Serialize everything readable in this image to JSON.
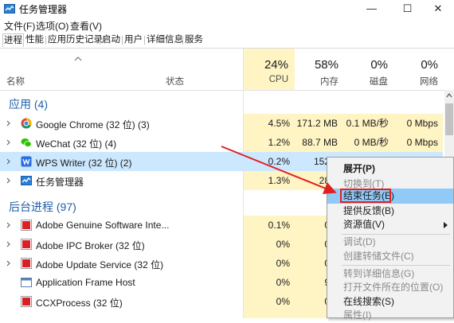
{
  "window": {
    "title": "任务管理器",
    "minimize": "—",
    "maximize": "☐",
    "close": "✕"
  },
  "menu": [
    "文件(F)",
    "选项(O)",
    "查看(V)"
  ],
  "tabs": [
    "进程",
    "性能",
    "应用历史记录",
    "启动",
    "用户",
    "详细信息",
    "服务"
  ],
  "columns": {
    "name": "名称",
    "status": "状态",
    "cpu": {
      "pct": "24%",
      "label": "CPU"
    },
    "mem": {
      "pct": "58%",
      "label": "内存"
    },
    "disk": {
      "pct": "0%",
      "label": "磁盘"
    },
    "net": {
      "pct": "0%",
      "label": "网络"
    }
  },
  "groups": {
    "apps": "应用 (4)",
    "background": "后台进程 (97)"
  },
  "apps": [
    {
      "name": "Google Chrome (32 位) (3)",
      "icon": "chrome-icon",
      "cpu": "4.5%",
      "mem": "171.2 MB",
      "disk": "0.1 MB/秒",
      "net": "0 Mbps"
    },
    {
      "name": "WeChat (32 位) (4)",
      "icon": "wechat-icon",
      "cpu": "1.2%",
      "mem": "88.7 MB",
      "disk": "0 MB/秒",
      "net": "0 Mbps"
    },
    {
      "name": "WPS Writer (32 位) (2)",
      "icon": "wps-writer-icon",
      "cpu": "0.2%",
      "mem": "152.6",
      "disk": "",
      "net": ""
    },
    {
      "name": "任务管理器",
      "icon": "task-manager-icon",
      "cpu": "1.3%",
      "mem": "28.0",
      "disk": "",
      "net": ""
    }
  ],
  "background": [
    {
      "name": "Adobe Genuine Software Inte...",
      "icon": "adobe-icon",
      "cpu": "0.1%",
      "mem": "0.2"
    },
    {
      "name": "Adobe IPC Broker (32 位)",
      "icon": "adobe-icon",
      "cpu": "0%",
      "mem": "0.3"
    },
    {
      "name": "Adobe Update Service (32 位)",
      "icon": "adobe-icon",
      "cpu": "0%",
      "mem": "0.3"
    },
    {
      "name": "Application Frame Host",
      "icon": "app-frame-icon",
      "cpu": "0%",
      "mem": "9.7"
    },
    {
      "name": "CCXProcess (32 位)",
      "icon": "adobe-icon",
      "cpu": "0%",
      "mem": "0.3"
    }
  ],
  "context_menu": [
    {
      "label": "展开(P)",
      "style": "bold"
    },
    {
      "label": "切换到(T)",
      "style": "disabled"
    },
    {
      "label": "结束任务(E)",
      "style": "hl"
    },
    {
      "label": "提供反馈(B)",
      "style": ""
    },
    {
      "label": "资源值(V)",
      "style": "",
      "submenu": true
    },
    {
      "label": "调试(D)",
      "style": "disabled"
    },
    {
      "label": "创建转储文件(C)",
      "style": "disabled"
    },
    {
      "label": "转到详细信息(G)",
      "style": "disabled"
    },
    {
      "label": "打开文件所在的位置(O)",
      "style": "disabled"
    },
    {
      "label": "在线搜索(S)",
      "style": ""
    },
    {
      "label": "属性(I)",
      "style": "disabled"
    }
  ],
  "colors": {
    "accent": "#1f5fa8",
    "selection": "#cce8ff",
    "cpu_heat": "#fff4c4",
    "annotation": "#e02020"
  }
}
